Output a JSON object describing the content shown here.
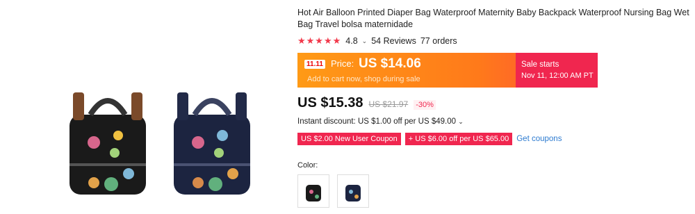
{
  "product": {
    "title": "Hot Air Balloon Printed Diaper Bag Waterproof Maternity Baby Backpack Waterproof Nursing Bag Wet Bag Travel bolsa maternidade",
    "rating": "4.8",
    "reviews": "54 Reviews",
    "orders": "77 orders"
  },
  "promo": {
    "badge": "11.11",
    "price_label": "Price:",
    "price_value": "US $14.06",
    "subtext": "Add to cart now, shop during sale",
    "sale_starts": "Sale starts",
    "sale_time": "Nov 11, 12:00 AM PT",
    "colors": {
      "left": "#ff9a16",
      "right": "#f0264f"
    }
  },
  "price": {
    "current": "US $15.38",
    "original": "US $21.97",
    "discount": "-30%"
  },
  "instant_discount": "Instant discount: US $1.00 off per US $49.00",
  "coupons": [
    {
      "label": "US $2.00 New User Coupon"
    },
    {
      "label": "+ US $6.00 off per US $65.00"
    }
  ],
  "get_coupons": "Get coupons",
  "color_label": "Color:",
  "icons": [
    "star-icon",
    "chevron-down-icon"
  ]
}
